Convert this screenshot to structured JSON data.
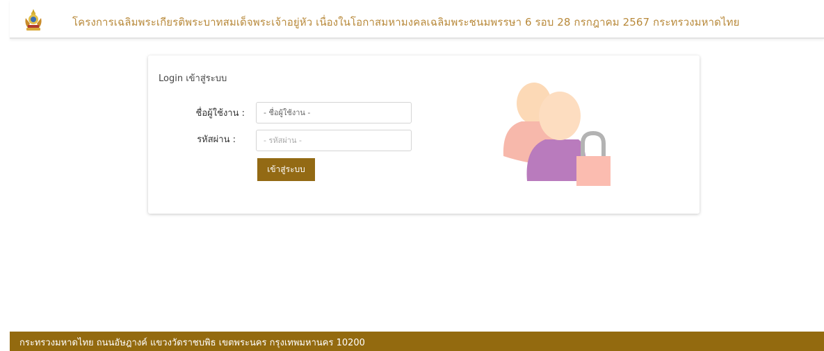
{
  "header": {
    "title": "โครงการเฉลิมพระเกียรติพระบาทสมเด็จพระเจ้าอยู่หัว เนื่องในโอกาสมหามงคลเฉลิมพระชนมพรรษา 6 รอบ 28 กรกฎาคม 2567 กระทรวงมหาดไทย",
    "title_color": "#b8893a",
    "emblem_icon": "royal-emblem-icon"
  },
  "login": {
    "title": "Login เข้าสู่ระบบ",
    "username_label": "ชื่อผู้ใช้งาน :",
    "username_placeholder": "- ชื่อผู้ใช้งาน -",
    "password_label": "รหัสผ่าน :",
    "password_placeholder": "- รหัสผ่าน -",
    "submit_label": "เข้าสู่ระบบ",
    "button_color": "#936a14",
    "illustration_icon": "users-lock-icon"
  },
  "footer": {
    "address": "กระทรวงมหาดไทย  ถนนอัษฎางค์ แขวงวัดราชบพิธ เขตพระนคร กรุงเทพมหานคร 10200",
    "background_color": "#936a0f"
  }
}
